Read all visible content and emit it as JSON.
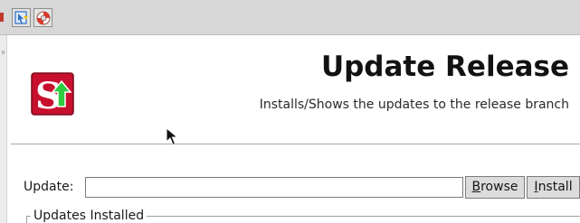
{
  "toolbar": {
    "buttons": [
      {
        "icon": "update-tool-icon",
        "color": "#2d6fc2"
      },
      {
        "icon": "lifebuoy-icon",
        "color": "#e03a2e"
      }
    ]
  },
  "header": {
    "logo_icon": "s-update-logo-icon",
    "logo_colors": {
      "background": "#c8102e",
      "arrow": "#2ecc40"
    },
    "title": "Update Release",
    "subtitle": "Installs/Shows the updates to the release branch"
  },
  "update": {
    "label": "Update:",
    "value": "",
    "browse_button": {
      "first": "B",
      "rest": "rowse"
    },
    "install_button": {
      "first": "I",
      "rest": "nstall"
    }
  },
  "installed": {
    "legend": "Updates Installed"
  }
}
